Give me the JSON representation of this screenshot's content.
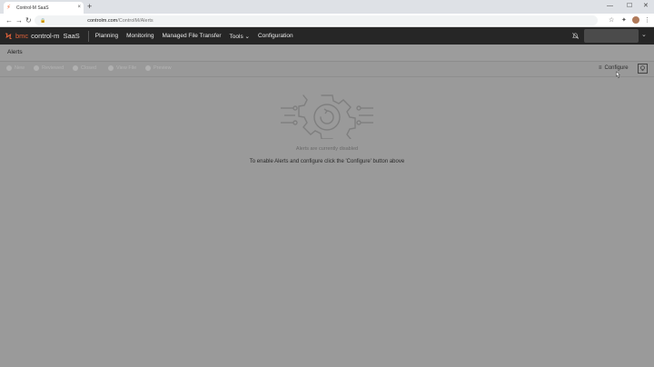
{
  "browser": {
    "tab_title": "Control-M SaaS",
    "tab_close": "×",
    "new_tab": "+",
    "minimize": "—",
    "maximize": "☐",
    "close": "✕",
    "url_host": "controlm.com",
    "url_path": "/ControlM/Alerts",
    "back": "←",
    "forward": "→",
    "reload": "↻",
    "star": "☆",
    "extensions": "✦",
    "menu": "⋮"
  },
  "app": {
    "brand_name": "bmc",
    "brand_product": "control-m",
    "brand_saas": "SaaS",
    "nav": [
      "Planning",
      "Monitoring",
      "Managed File Transfer",
      "Tools ⌄",
      "Configuration"
    ],
    "user_menu": "⌄"
  },
  "page": {
    "title": "Alerts",
    "toolbar": {
      "buttons": [
        "New",
        "Reviewed",
        "Closed",
        "View File",
        "Preview"
      ],
      "configure": "Configure",
      "configure_icon": "≡"
    },
    "empty": {
      "caption": "Alerts are currently disabled",
      "instruction": "To enable Alerts and configure click the 'Configure' button above"
    }
  },
  "colors": {
    "accent": "#e0623a",
    "header_bg": "#262626",
    "page_bg": "#9a9a9a"
  }
}
